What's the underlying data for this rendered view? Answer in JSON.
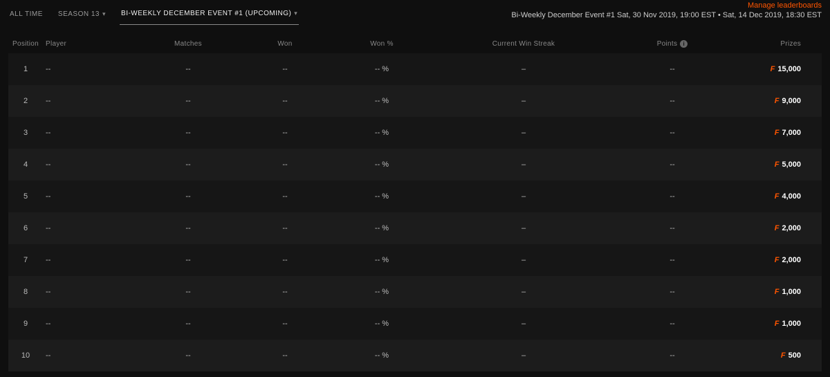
{
  "tabs": {
    "all_time": "ALL TIME",
    "season": "SEASON 13",
    "event": "BI-WEEKLY DECEMBER EVENT #1 (UPCOMING)"
  },
  "manage_link": "Manage leaderboards",
  "event_info": "Bi-Weekly December Event #1  Sat, 30 Nov 2019, 19:00 EST • Sat, 14 Dec 2019, 18:30 EST",
  "columns": {
    "position": "Position",
    "player": "Player",
    "matches": "Matches",
    "won": "Won",
    "wonpct": "Won %",
    "streak": "Current Win Streak",
    "points": "Points",
    "prizes": "Prizes"
  },
  "currency_symbol": "F",
  "rows": [
    {
      "position": "1",
      "player": "--",
      "matches": "--",
      "won": "--",
      "wonpct": "-- %",
      "streak": "–",
      "points": "--",
      "prize": "15,000"
    },
    {
      "position": "2",
      "player": "--",
      "matches": "--",
      "won": "--",
      "wonpct": "-- %",
      "streak": "–",
      "points": "--",
      "prize": "9,000"
    },
    {
      "position": "3",
      "player": "--",
      "matches": "--",
      "won": "--",
      "wonpct": "-- %",
      "streak": "–",
      "points": "--",
      "prize": "7,000"
    },
    {
      "position": "4",
      "player": "--",
      "matches": "--",
      "won": "--",
      "wonpct": "-- %",
      "streak": "–",
      "points": "--",
      "prize": "5,000"
    },
    {
      "position": "5",
      "player": "--",
      "matches": "--",
      "won": "--",
      "wonpct": "-- %",
      "streak": "–",
      "points": "--",
      "prize": "4,000"
    },
    {
      "position": "6",
      "player": "--",
      "matches": "--",
      "won": "--",
      "wonpct": "-- %",
      "streak": "–",
      "points": "--",
      "prize": "2,000"
    },
    {
      "position": "7",
      "player": "--",
      "matches": "--",
      "won": "--",
      "wonpct": "-- %",
      "streak": "–",
      "points": "--",
      "prize": "2,000"
    },
    {
      "position": "8",
      "player": "--",
      "matches": "--",
      "won": "--",
      "wonpct": "-- %",
      "streak": "–",
      "points": "--",
      "prize": "1,000"
    },
    {
      "position": "9",
      "player": "--",
      "matches": "--",
      "won": "--",
      "wonpct": "-- %",
      "streak": "–",
      "points": "--",
      "prize": "1,000"
    },
    {
      "position": "10",
      "player": "--",
      "matches": "--",
      "won": "--",
      "wonpct": "-- %",
      "streak": "–",
      "points": "--",
      "prize": "500"
    }
  ]
}
